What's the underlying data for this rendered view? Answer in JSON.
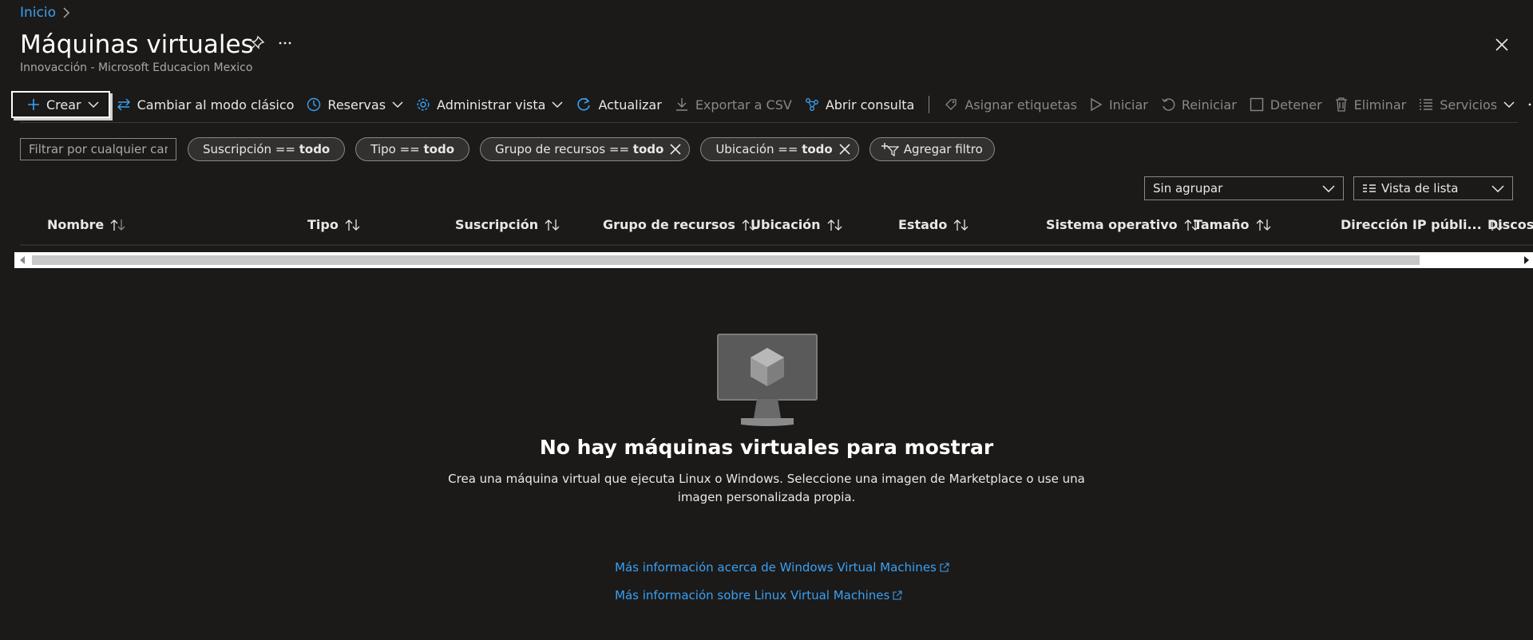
{
  "breadcrumb": {
    "home": "Inicio"
  },
  "page": {
    "title": "Máquinas virtuales",
    "subtitle": "Innovacción - Microsoft Educacion Mexico"
  },
  "toolbar": {
    "create": "Crear",
    "classic": "Cambiar al modo clásico",
    "reservations": "Reservas",
    "manage_view": "Administrar vista",
    "refresh": "Actualizar",
    "export_csv": "Exportar a CSV",
    "open_query": "Abrir consulta",
    "assign_tags": "Asignar etiquetas",
    "start": "Iniciar",
    "restart": "Reiniciar",
    "stop": "Detener",
    "delete": "Eliminar",
    "services": "Servicios"
  },
  "filters": {
    "search_placeholder": "Filtrar por cualquier campo...",
    "pills": [
      {
        "label": "Suscripción == ",
        "value": "todo"
      },
      {
        "label": "Tipo == ",
        "value": "todo"
      },
      {
        "label": "Grupo de recursos == ",
        "value": "todo"
      },
      {
        "label": "Ubicación == ",
        "value": "todo"
      }
    ],
    "add_filter": "Agregar filtro"
  },
  "view": {
    "grouping": "Sin agrupar",
    "list_view": "Vista de lista"
  },
  "table": {
    "columns": [
      "Nombre",
      "Tipo",
      "Suscripción",
      "Grupo de recursos",
      "Ubicación",
      "Estado",
      "Sistema operativo",
      "Tamaño",
      "Dirección IP públi...",
      "Discos"
    ],
    "rows": []
  },
  "empty_state": {
    "title": "No hay máquinas virtuales para mostrar",
    "description": "Crea una máquina virtual que ejecuta Linux o Windows. Seleccione una imagen de Marketplace o use una imagen personalizada propia.",
    "link_windows": "Más información acerca de Windows Virtual Machines",
    "link_linux": "Más información sobre Linux Virtual Machines"
  },
  "colors": {
    "background": "#1b1a19",
    "accent": "#3aa0f3",
    "disabled": "#8a8886"
  }
}
